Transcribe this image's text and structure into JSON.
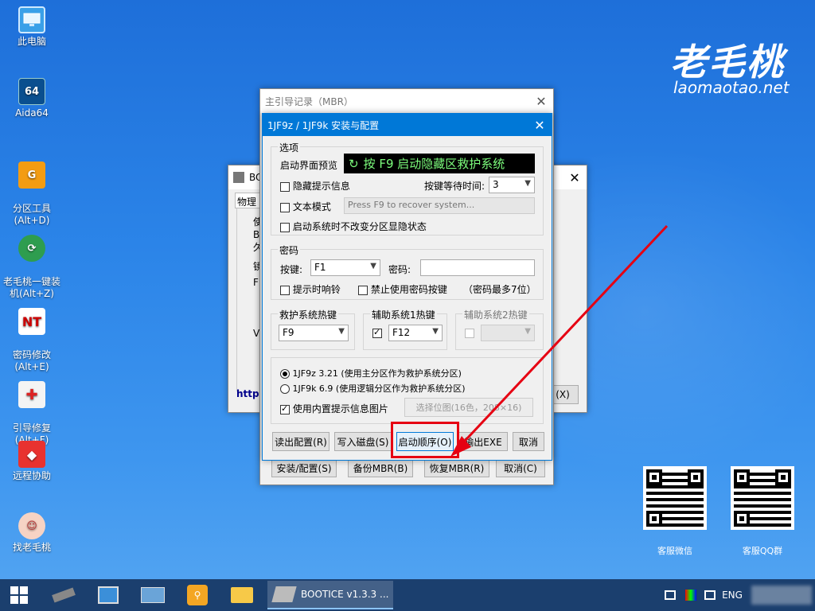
{
  "desktop": {
    "icons": [
      {
        "label": "此电脑",
        "icon": "computer-icon"
      },
      {
        "label": "Aida64",
        "badge": "64",
        "icon": "aida64-icon"
      },
      {
        "label": "分区工具\n(Alt+D)",
        "icon": "partition-tool-icon"
      },
      {
        "label": "老毛桃一键装\n机(Alt+Z)",
        "icon": "onekey-install-icon"
      },
      {
        "label": "密码修改\n(Alt+E)",
        "icon": "password-change-icon"
      },
      {
        "label": "引导修复\n(Alt+F)",
        "icon": "boot-repair-icon"
      },
      {
        "label": "远程协助",
        "icon": "remote-assist-icon"
      },
      {
        "label": "找老毛桃",
        "icon": "find-laomaotao-icon"
      }
    ],
    "brand_logo": "老毛桃",
    "brand_url": "laomaotao.net",
    "qr_codes": [
      {
        "label": "客服微信"
      },
      {
        "label": "客服QQ群"
      }
    ]
  },
  "bootice_window": {
    "title_prefix": "BO",
    "tab": "物理",
    "left_snippets": [
      "使",
      "Bo",
      "久",
      "镜",
      "F",
      "VH"
    ],
    "link_text": "http:",
    "exit_button": "(X)"
  },
  "mbr_window": {
    "title": "主引导记录（MBR）",
    "buttons": {
      "install": "安装/配置(S)",
      "backup": "备份MBR(B)",
      "restore": "恢复MBR(R)",
      "cancel": "取消(C)"
    }
  },
  "dialog": {
    "title": "1JF9z / 1JF9k 安装与配置",
    "options_group": "选项",
    "preview_label": "启动界面预览",
    "preview_text": "按 F9 启动隐藏区救护系统",
    "hide_tips_label": "隐藏提示信息",
    "wait_time_label": "按键等待时间:",
    "wait_time_value": "3",
    "text_mode_label": "文本模式",
    "text_mode_placeholder": "Press F9 to recover system...",
    "no_change_label": "启动系统时不改变分区显隐状态",
    "password_group": "密码",
    "key_label": "按键:",
    "key_value": "F1",
    "password_label": "密码:",
    "password_value": "",
    "beep_label": "提示时响铃",
    "disable_pwd_key_label": "禁止使用密码按键",
    "pwd_note": "（密码最多7位）",
    "rescue_hotkey_group": "救护系统热键",
    "rescue_hotkey_value": "F9",
    "aux1_group": "辅助系统1热键",
    "aux1_value": "F12",
    "aux1_checked": true,
    "aux2_group": "辅助系统2热键",
    "aux2_checked": false,
    "radio1_label": "1JF9z 3.21 (使用主分区作为救护系统分区)",
    "radio2_label": "1JF9k 6.9 (使用逻辑分区作为救护系统分区)",
    "use_builtin_image_label": "使用内置提示信息图片",
    "select_bitmap_button": "选择位图(16色，208×16)",
    "buttons": {
      "read_config": "读出配置(R)",
      "write_disk": "写入磁盘(S)",
      "boot_order": "启动顺序(O)",
      "export_exe": "输出EXE",
      "cancel": "取消"
    }
  },
  "taskbar": {
    "app_label": "BOOTICE v1.3.3 ...",
    "language": "ENG"
  },
  "colors": {
    "annotation": "#e60012",
    "preview_text": "#7cfc7c",
    "dialog_title_bg": "#0078d7",
    "taskbar_bg": "#1b3f6e"
  }
}
